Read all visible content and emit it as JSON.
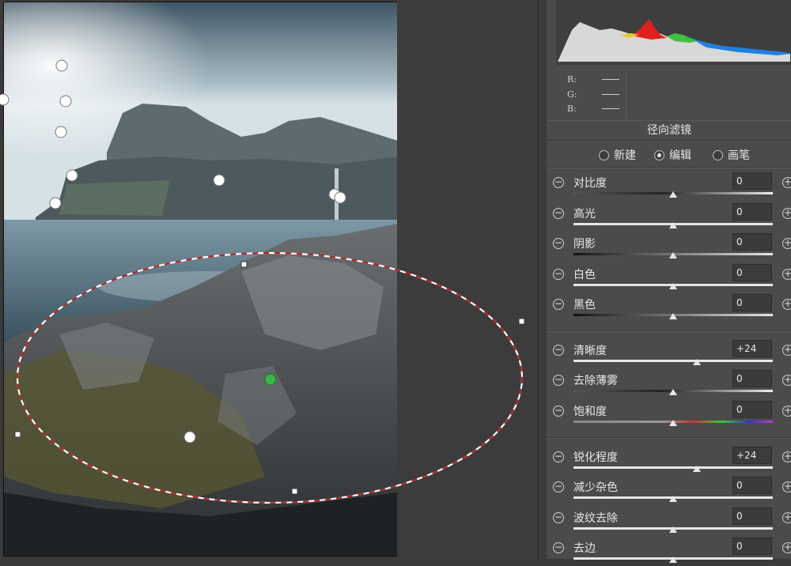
{
  "panel": {
    "title": "径向滤镜",
    "modes": [
      {
        "label": "新建",
        "selected": false
      },
      {
        "label": "编辑",
        "selected": true
      },
      {
        "label": "画笔",
        "selected": false
      }
    ],
    "rgb": [
      {
        "channel": "R:"
      },
      {
        "channel": "G:"
      },
      {
        "channel": "B:"
      }
    ],
    "sliders": [
      {
        "label": "对比度",
        "value": "0",
        "level": 0.5
      },
      {
        "label": "高光",
        "value": "0",
        "level": 0.5
      },
      {
        "label": "阴影",
        "value": "0",
        "level": 0.5
      },
      {
        "label": "白色",
        "value": "0",
        "level": 0.5
      },
      {
        "label": "黑色",
        "value": "0",
        "level": 0.5
      },
      {
        "label": "清晰度",
        "value": "+24",
        "level": 0.62
      },
      {
        "label": "去除薄雾",
        "value": "0",
        "level": 0.5
      },
      {
        "label": "饱和度",
        "value": "0",
        "level": 0.5
      },
      {
        "label": "锐化程度",
        "value": "+24",
        "level": 0.62
      },
      {
        "label": "减少杂色",
        "value": "0",
        "level": 0.5
      },
      {
        "label": "波纹去除",
        "value": "0",
        "level": 0.5
      },
      {
        "label": "去边",
        "value": "0",
        "level": 0.5
      }
    ],
    "symbols": {
      "minus": "−",
      "plus": "+"
    }
  },
  "colors": {
    "panel_bg": "#4b4b4b",
    "mask_dash_red": "#b02a2a",
    "pin_active": "#39b54a"
  }
}
